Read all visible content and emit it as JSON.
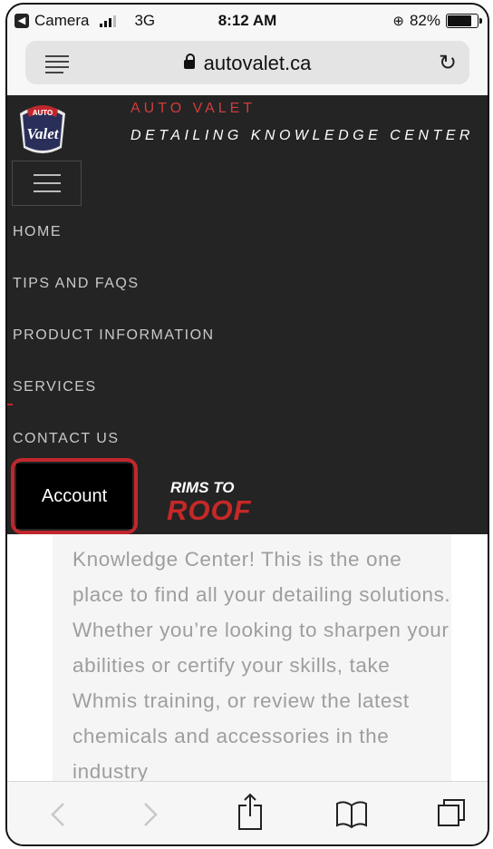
{
  "status_bar": {
    "back_app": "Camera",
    "network": "3G",
    "time": "8:12 AM",
    "battery_percent": "82%",
    "battery_level": 0.82
  },
  "browser": {
    "url": "autovalet.ca"
  },
  "site": {
    "logo_text_top": "AUTO",
    "logo_text_main": "Valet",
    "brand_name": "AUTO VALET",
    "brand_subtitle": "DETAILING KNOWLEDGE CENTER",
    "nav": [
      "HOME",
      "TIPS AND FAQS",
      "PRODUCT INFORMATION",
      "SERVICES",
      "CONTACT US"
    ],
    "account_label": "Account",
    "partner_logo_top": "RIMS TO",
    "partner_logo_bottom": "ROOF"
  },
  "content": {
    "paragraph": "Knowledge Center! This is the one place to find all your detailing solutions. Whether you’re looking to sharpen your abilities or certify your skills, take Whmis training, or review the latest chemicals and accessories in the industry"
  },
  "colors": {
    "site_bg": "#242424",
    "brand_red": "#d23b3b",
    "highlight_red": "#c0272d"
  },
  "icons": {
    "toolbar": [
      "back-icon",
      "forward-icon",
      "share-icon",
      "bookmarks-icon",
      "tabs-icon"
    ]
  }
}
